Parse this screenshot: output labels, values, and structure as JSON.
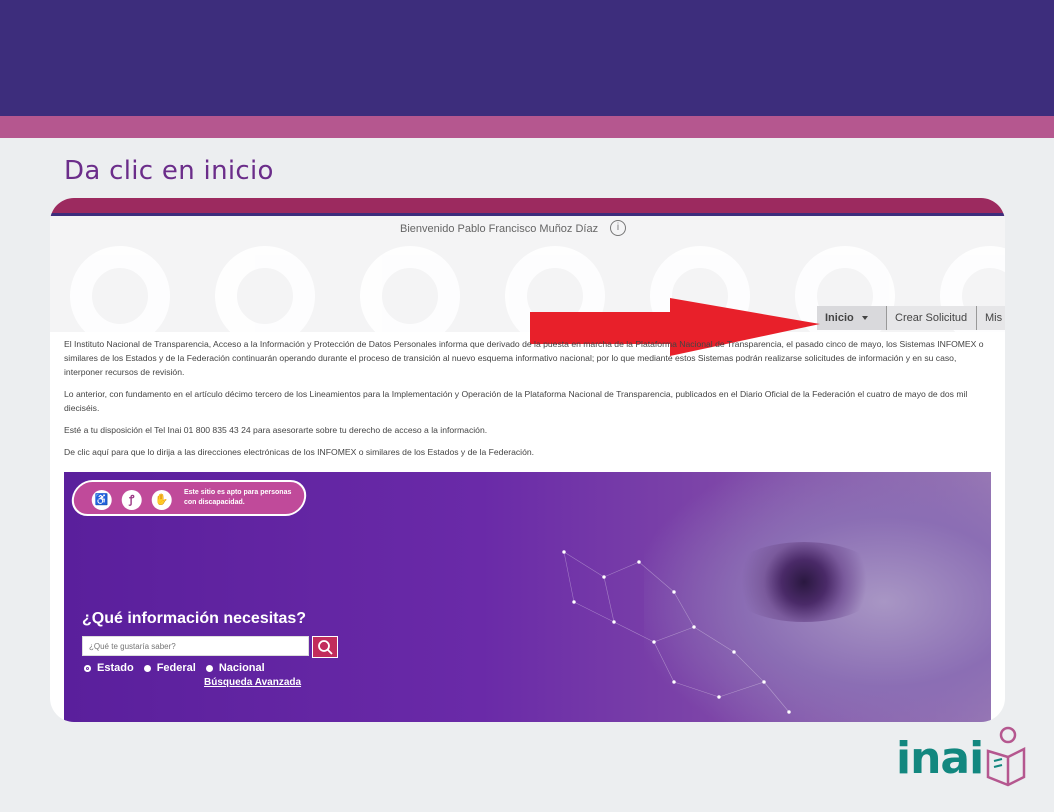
{
  "slide": {
    "title": "Da clic en inicio"
  },
  "screenshot": {
    "welcome": "Bienvenido Pablo Francisco Muñoz Díaz",
    "nav": {
      "inicio_label": "Inicio",
      "crear_label": "Crear Solicitud",
      "mis_label": "Mis"
    },
    "paragraphs": [
      "El Instituto Nacional de Transparencia, Acceso a la Información y Protección de Datos Personales informa que derivado de la puesta en marcha de la Plataforma Nacional de Transparencia, el pasado cinco de mayo, los Sistemas INFOMEX o similares de los Estados y de la Federación continuarán operando durante el proceso de transición al nuevo esquema informativo nacional; por lo que mediante estos Sistemas podrán realizarse solicitudes de información y en su caso, interponer recursos de revisión.",
      "Lo anterior, con fundamento en el artículo décimo tercero de los Lineamientos para la Implementación y Operación de la Plataforma Nacional de Transparencia, publicados en el Diario Oficial de la Federación el cuatro de mayo de dos mil dieciséis.",
      "Esté a tu disposición el Tel Inai 01 800 835 43 24 para asesorarte sobre tu derecho de acceso a la información.",
      "De clic aquí para que lo dirija a las direcciones electrónicas de los INFOMEX o similares de los Estados y de la Federación."
    ],
    "banner": {
      "accessibility_text": "Este sitio es apto para personas con discapacidad.",
      "question": "¿Qué información necesitas?",
      "search_placeholder": "¿Qué te gustaría saber?",
      "radios": [
        "Estado",
        "Federal",
        "Nacional"
      ],
      "advanced_search": "Búsqueda Avanzada"
    }
  },
  "logo": {
    "text": "inai"
  },
  "colors": {
    "header": "#3d2d7c",
    "accent_band": "#b5578f",
    "title": "#6b2d8a",
    "arrow": "#e8202a",
    "logo": "#12877f"
  }
}
